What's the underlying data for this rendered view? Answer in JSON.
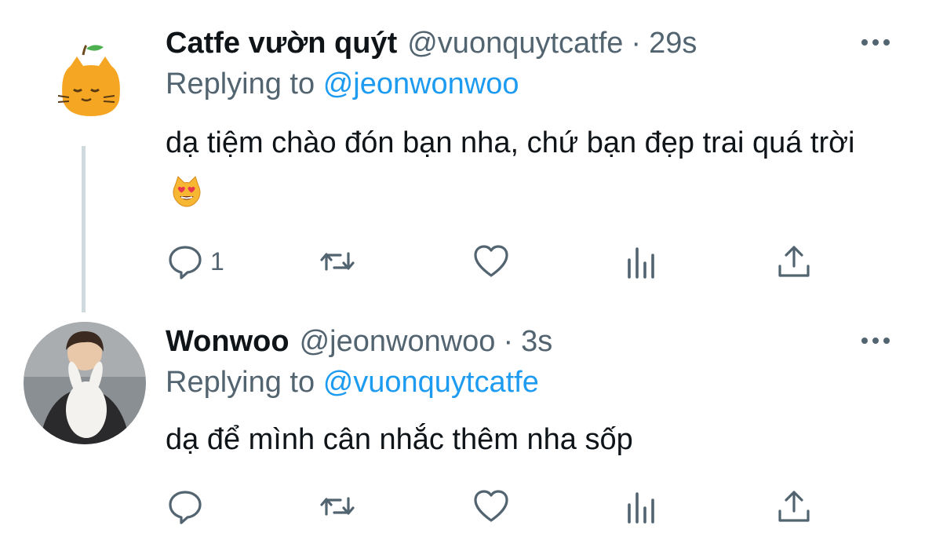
{
  "tweets": [
    {
      "name": "Catfe vườn quýt",
      "handle": "@vuonquytcatfe",
      "separator": "·",
      "time": "29s",
      "replying_prefix": "Replying to",
      "replying_to": "@jeonwonwoo",
      "text": "dạ tiệm chào đón bạn nha, chứ bạn đẹp trai quá trời",
      "emoji": "smiling-cat-heart-eyes",
      "reply_count": "1"
    },
    {
      "name": "Wonwoo",
      "handle": "@jeonwonwoo",
      "separator": "·",
      "time": "3s",
      "replying_prefix": "Replying to",
      "replying_to": "@vuonquytcatfe",
      "text": "dạ để mình cân nhắc thêm nha sốp",
      "reply_count": ""
    }
  ],
  "colors": {
    "text": "#0f1419",
    "secondary": "#536471",
    "accent": "#1d9bf0",
    "thread_line": "#cfd9de"
  },
  "icons": [
    "reply-icon",
    "retweet-icon",
    "like-icon",
    "views-icon",
    "share-icon",
    "more-icon"
  ]
}
